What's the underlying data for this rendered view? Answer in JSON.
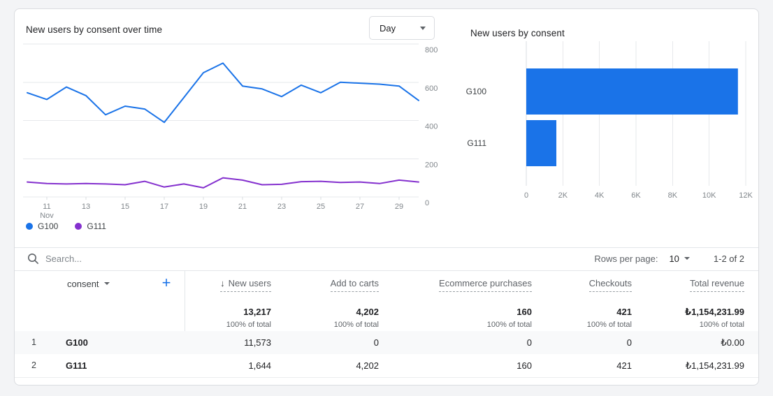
{
  "line_card": {
    "title": "New users by consent over time",
    "granularity": {
      "value": "Day"
    }
  },
  "bar_card": {
    "title": "New users by consent"
  },
  "chart_data": [
    {
      "type": "line",
      "title": "New users by consent over time",
      "x": [
        10,
        11,
        12,
        13,
        14,
        15,
        16,
        17,
        18,
        19,
        20,
        21,
        22,
        23,
        24,
        25,
        26,
        27,
        28,
        29,
        30
      ],
      "x_axis": {
        "ticks": [
          11,
          13,
          15,
          17,
          19,
          21,
          23,
          25,
          27,
          29
        ],
        "month_label": "Nov"
      },
      "series": [
        {
          "name": "G100",
          "color": "#1a73e8",
          "values": [
            545,
            510,
            575,
            530,
            430,
            475,
            460,
            390,
            520,
            650,
            700,
            580,
            565,
            525,
            585,
            545,
            600,
            595,
            590,
            580,
            505
          ]
        },
        {
          "name": "G111",
          "color": "#8430ce",
          "values": [
            78,
            70,
            68,
            70,
            68,
            64,
            82,
            52,
            68,
            48,
            100,
            88,
            64,
            66,
            80,
            82,
            76,
            78,
            70,
            88,
            78
          ]
        }
      ],
      "ylim": [
        0,
        800
      ],
      "yticks": [
        0,
        200,
        400,
        600,
        800
      ],
      "grid": "horizontal",
      "legend_position": "bottom-left"
    },
    {
      "type": "bar",
      "orientation": "horizontal",
      "title": "New users by consent",
      "categories": [
        "G100",
        "G111"
      ],
      "values": [
        11573,
        1644
      ],
      "xlim": [
        0,
        12000
      ],
      "xticks": [
        0,
        2000,
        4000,
        6000,
        8000,
        10000,
        12000
      ],
      "xticks_labels": [
        "0",
        "2K",
        "4K",
        "6K",
        "8K",
        "10K",
        "12K"
      ],
      "bar_color": "#1a73e8",
      "grid": "vertical"
    }
  ],
  "icons": {
    "sort_descending": "↓",
    "plus": "+"
  },
  "table": {
    "search_placeholder": "Search...",
    "rows_per_page_label": "Rows per page:",
    "rows_per_page_value": "10",
    "pagination_range": "1-2 of 2",
    "dimension_header": "consent",
    "columns": [
      {
        "label": "New users",
        "sorted": "descending"
      },
      {
        "label": "Add to carts"
      },
      {
        "label": "Ecommerce purchases"
      },
      {
        "label": "Checkouts"
      },
      {
        "label": "Total revenue"
      }
    ],
    "totals": {
      "values": [
        "13,217",
        "4,202",
        "160",
        "421",
        "₺1,154,231.99"
      ],
      "subtext": "100% of total"
    },
    "rows": [
      {
        "index": "1",
        "dimension": "G100",
        "values": [
          "11,573",
          "0",
          "0",
          "0",
          "₺0.00"
        ]
      },
      {
        "index": "2",
        "dimension": "G111",
        "values": [
          "1,644",
          "4,202",
          "160",
          "421",
          "₺1,154,231.99"
        ]
      }
    ]
  },
  "colors": {
    "series_blue": "#1a73e8",
    "series_purple": "#8430ce",
    "accent_blue": "#1a73e8"
  }
}
